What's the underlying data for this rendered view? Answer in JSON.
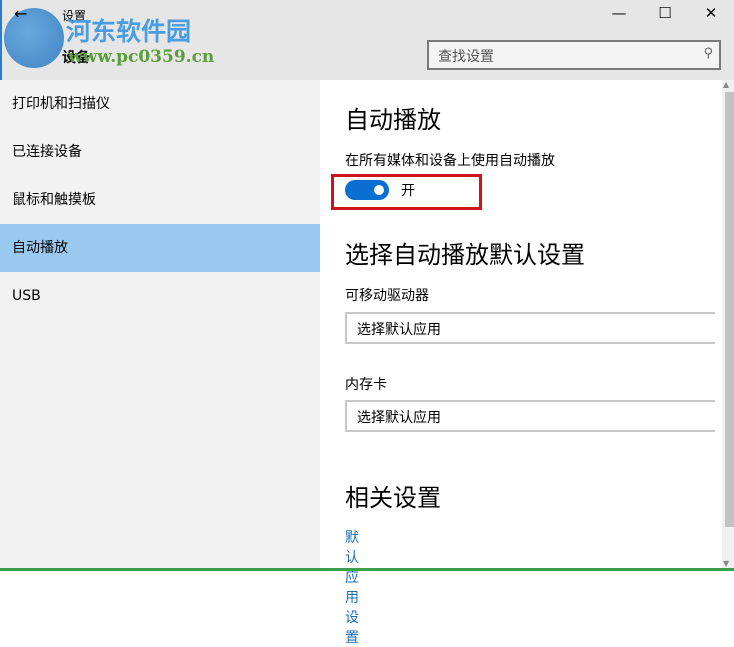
{
  "window": {
    "title": "设置",
    "section": "设备",
    "back": "←",
    "minimize": "—",
    "maximize": "☐",
    "close": "✕"
  },
  "watermark": {
    "name": "河东软件园",
    "url": "www.pc0359.cn"
  },
  "search": {
    "placeholder": "查找设置",
    "icon": "⚲"
  },
  "sidebar": {
    "items": [
      {
        "label": "打印机和扫描仪"
      },
      {
        "label": "已连接设备"
      },
      {
        "label": "鼠标和触摸板"
      },
      {
        "label": "自动播放"
      },
      {
        "label": "USB"
      }
    ],
    "selected": 3
  },
  "autoplay": {
    "heading": "自动播放",
    "toggle_label": "在所有媒体和设备上使用自动播放",
    "toggle_state": "开",
    "toggle_on": true
  },
  "defaults": {
    "heading": "选择自动播放默认设置",
    "removable_label": "可移动驱动器",
    "removable_value": "选择默认应用",
    "memcard_label": "内存卡",
    "memcard_value": "选择默认应用"
  },
  "related": {
    "heading": "相关设置",
    "link": "默认应用设置"
  }
}
